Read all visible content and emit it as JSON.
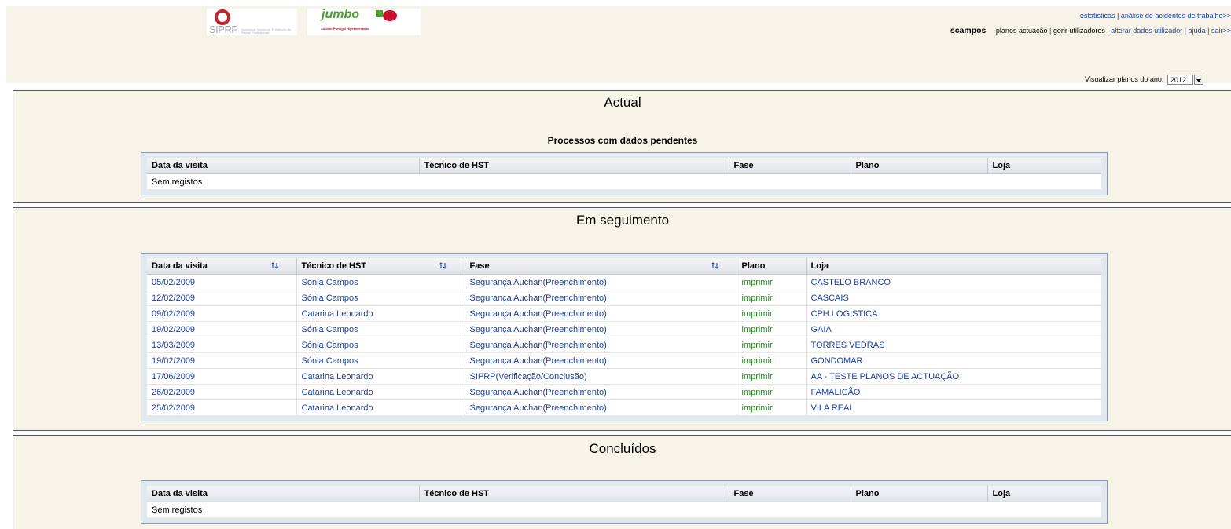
{
  "colors": {
    "header_bg": "#f6f4e8",
    "link_blue": "#1f3f9e",
    "print_green": "#1e8a1e",
    "grid_frame": "#e3e8ef"
  },
  "logos": {
    "siprp_name": "SIPRP",
    "siprp_tag": "Sociedade Ibérica de Prevenção de Riscos Profissionais",
    "jumbo_name": "jumbo",
    "jumbo_tag": "Auchan Portugal Hipermercados"
  },
  "top_links": {
    "stats": "estatisticas",
    "sep": " | ",
    "accidents": "análise de acidentes de trabalho>>"
  },
  "user_nav": {
    "username": "scampos",
    "plans": "planos actuação",
    "manage_users": "gerir utilizadores",
    "change_user_data": "alterar dados utilizador",
    "help": "ajuda",
    "logout": "sair>>",
    "sep": " | "
  },
  "year_filter": {
    "label": "Visualizar planos do ano:",
    "value": "2012"
  },
  "columns": {
    "date": "Data da visita",
    "tech": "Técnico de HST",
    "phase": "Fase",
    "plan": "Plano",
    "store": "Loja"
  },
  "sections": {
    "actual": {
      "title": "Actual",
      "subtitle": "Processos com dados pendentes",
      "empty": "Sem registos"
    },
    "seguimento": {
      "title": "Em seguimento",
      "rows": [
        {
          "date": "05/02/2009",
          "tech": "Sónia Campos",
          "phase": "Segurança Auchan(Preenchimento)",
          "plan": "imprimir",
          "store": "CASTELO BRANCO"
        },
        {
          "date": "12/02/2009",
          "tech": "Sónia Campos",
          "phase": "Segurança Auchan(Preenchimento)",
          "plan": "imprimir",
          "store": "CASCAIS"
        },
        {
          "date": "09/02/2009",
          "tech": "Catarina Leonardo",
          "phase": "Segurança Auchan(Preenchimento)",
          "plan": "imprimir",
          "store": "CPH LOGISTICA"
        },
        {
          "date": "19/02/2009",
          "tech": "Sónia Campos",
          "phase": "Segurança Auchan(Preenchimento)",
          "plan": "imprimir",
          "store": "GAIA"
        },
        {
          "date": "13/03/2009",
          "tech": "Sónia Campos",
          "phase": "Segurança Auchan(Preenchimento)",
          "plan": "imprimir",
          "store": "TORRES VEDRAS"
        },
        {
          "date": "19/02/2009",
          "tech": "Sónia Campos",
          "phase": "Segurança Auchan(Preenchimento)",
          "plan": "imprimir",
          "store": "GONDOMAR"
        },
        {
          "date": "17/06/2009",
          "tech": "Catarina Leonardo",
          "phase": "SIPRP(Verificação/Conclusão)",
          "plan": "imprimir",
          "store": "AA - TESTE PLANOS DE ACTUAÇÃO"
        },
        {
          "date": "26/02/2009",
          "tech": "Catarina Leonardo",
          "phase": "Segurança Auchan(Preenchimento)",
          "plan": "imprimir",
          "store": "FAMALICÃO"
        },
        {
          "date": "25/02/2009",
          "tech": "Catarina Leonardo",
          "phase": "Segurança Auchan(Preenchimento)",
          "plan": "imprimir",
          "store": "VILA REAL"
        }
      ]
    },
    "concluidos": {
      "title": "Concluídos",
      "empty": "Sem registos"
    }
  }
}
